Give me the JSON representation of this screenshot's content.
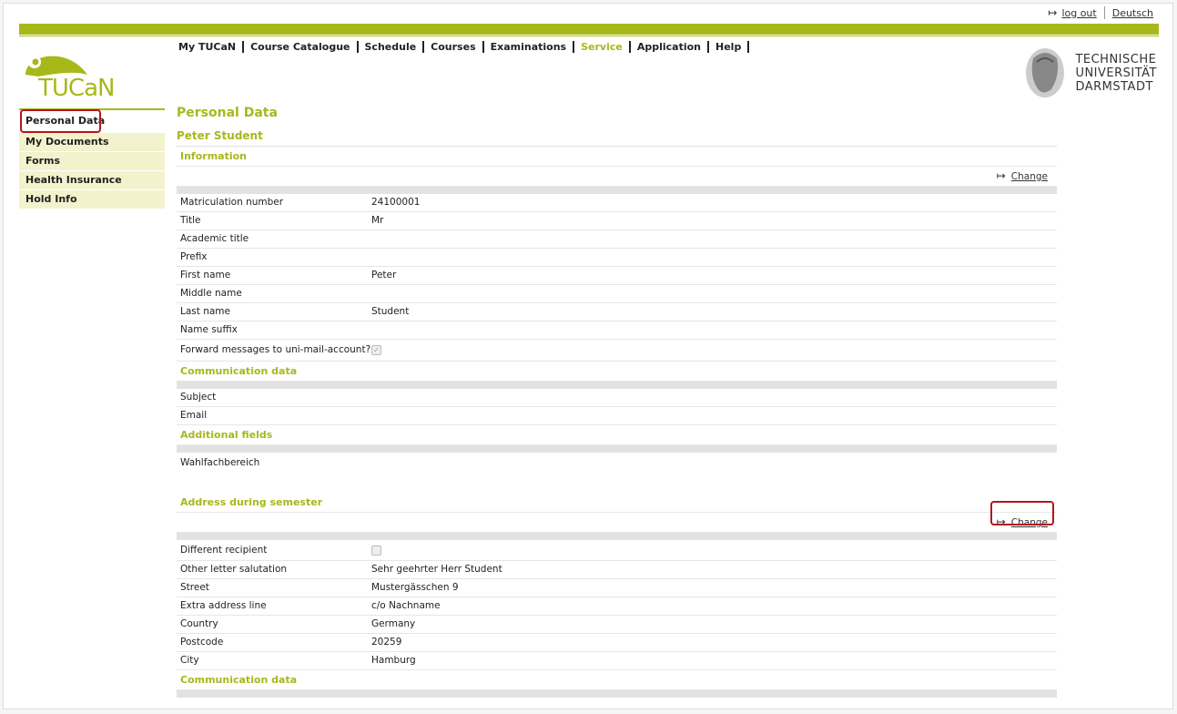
{
  "toplinks": {
    "logout": "log out",
    "language": "Deutsch"
  },
  "brand": {
    "logo_text": "TUCaN",
    "tud_line1": "TECHNISCHE",
    "tud_line2": "UNIVERSITÄT",
    "tud_line3": "DARMSTADT"
  },
  "nav": [
    "My TUCaN",
    "Course Catalogue",
    "Schedule",
    "Courses",
    "Examinations",
    "Service",
    "Application",
    "Help"
  ],
  "sidebar": [
    "Personal Data",
    "My Documents",
    "Forms",
    "Health Insurance",
    "Hold Info"
  ],
  "main": {
    "title": "Personal Data",
    "name": "Peter Student",
    "change_label": "Change",
    "sections": {
      "information": "Information",
      "communication": "Communication data",
      "additional": "Additional fields",
      "address": "Address during semester",
      "communication2": "Communication data"
    },
    "info_rows": [
      {
        "label": "Matriculation number",
        "value": "24100001"
      },
      {
        "label": "Title",
        "value": "Mr"
      },
      {
        "label": "Academic title",
        "value": ""
      },
      {
        "label": "Prefix",
        "value": ""
      },
      {
        "label": "First name",
        "value": "Peter"
      },
      {
        "label": "Middle name",
        "value": ""
      },
      {
        "label": "Last name",
        "value": "Student"
      },
      {
        "label": "Name suffix",
        "value": ""
      }
    ],
    "forward_label": "Forward messages to uni-mail-account?",
    "comm_rows": [
      {
        "label": "Subject",
        "value": ""
      },
      {
        "label": "Email",
        "value": ""
      }
    ],
    "additional_label": "Wahlfachbereich",
    "different_recipient": "Different recipient",
    "address_rows": [
      {
        "label": "Other letter salutation",
        "value": "Sehr geehrter Herr Student"
      },
      {
        "label": "Street",
        "value": "Mustergässchen 9"
      },
      {
        "label": "Extra address line",
        "value": "c/o Nachname"
      },
      {
        "label": "Country",
        "value": "Germany"
      },
      {
        "label": "Postcode",
        "value": "20259"
      },
      {
        "label": "City",
        "value": "Hamburg"
      }
    ]
  }
}
